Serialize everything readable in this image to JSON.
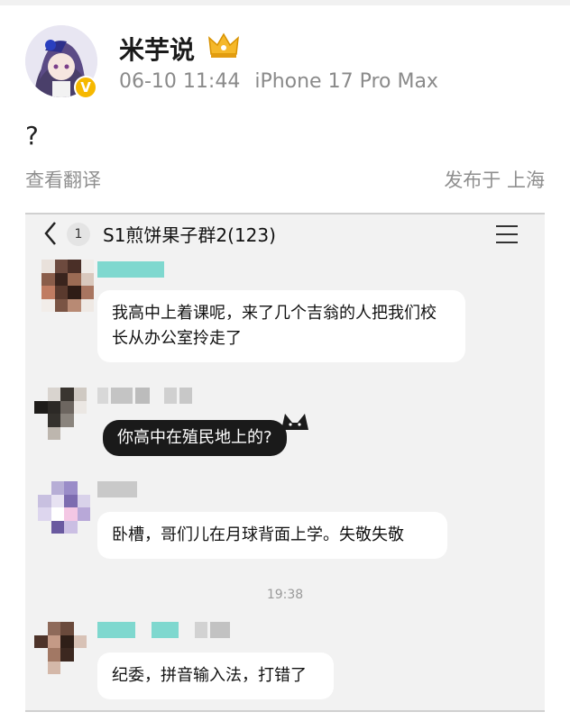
{
  "post": {
    "username": "米芋说",
    "date": "06-10 11:44",
    "device": "iPhone 17 Pro Max",
    "body": "?",
    "translate_label": "查看翻译",
    "location": "发布于 上海",
    "verified_badge": "V"
  },
  "chat": {
    "unread_count": "1",
    "group_title": "S1煎饼果子群2(123)",
    "messages": [
      {
        "text": "我高中上着课呢，来了几个吉翁的人把我们校长从办公室拎走了"
      },
      {
        "text": "你高中在殖民地上的?"
      },
      {
        "text": "卧槽，哥们儿在月球背面上学。失敬失敬"
      },
      {
        "text": "纪委，拼音输入法，打错了"
      }
    ],
    "timestamp": "19:38"
  },
  "colors": {
    "badge": "#f6b800",
    "teal_name": "#7fd8cf",
    "chat_bg": "#f2f2f2"
  }
}
